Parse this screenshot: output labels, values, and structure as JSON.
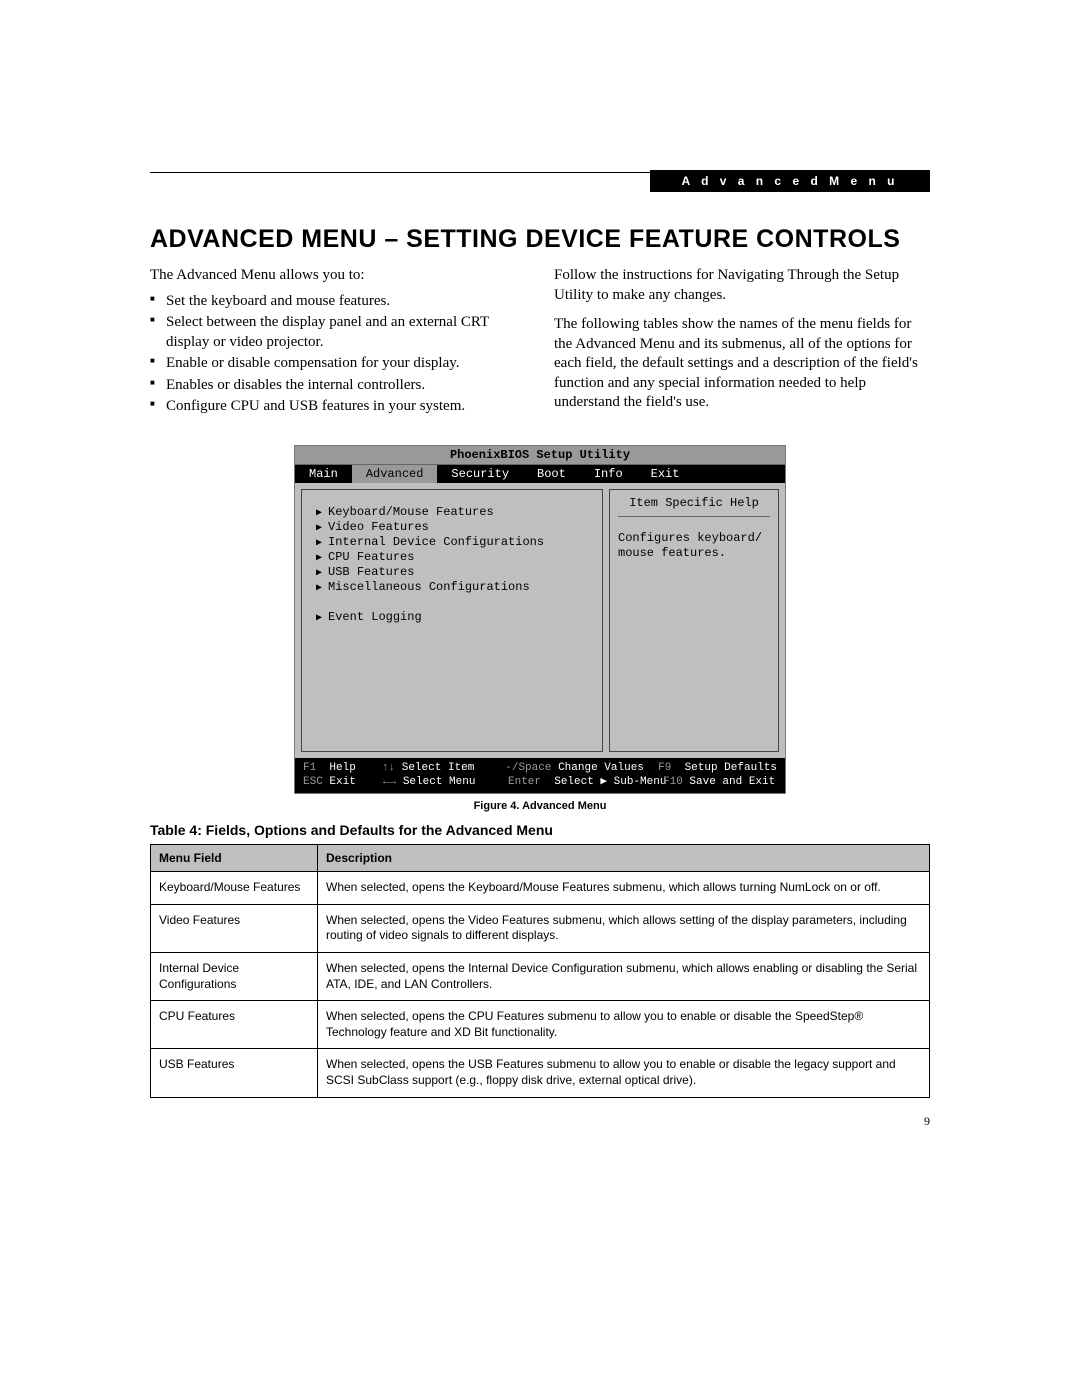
{
  "header": {
    "tag": "A d v a n c e d   M e n u",
    "title": "ADVANCED MENU – SETTING DEVICE FEATURE CONTROLS"
  },
  "intro": "The Advanced Menu allows you to:",
  "bullets": [
    "Set the keyboard and mouse features.",
    "Select between the display panel and an external CRT display or video projector.",
    "Enable or disable compensation for your display.",
    "Enables or disables the internal controllers.",
    "Configure CPU and USB features in your system."
  ],
  "right_paras": [
    "Follow the instructions for Navigating Through the Setup Utility to make any changes.",
    "The following tables show the names of the menu fields for the Advanced Menu and its submenus, all of the options for each field, the default settings and a description of the field's function and any special information needed to help understand the field's use."
  ],
  "bios": {
    "title": "PhoenixBIOS Setup Utility",
    "tabs": [
      "Main",
      "Advanced",
      "Security",
      "Boot",
      "Info",
      "Exit"
    ],
    "active_tab": "Advanced",
    "menu_items": [
      "Keyboard/Mouse Features",
      "Video Features",
      "Internal Device Configurations",
      "CPU Features",
      "USB Features",
      "Miscellaneous Configurations"
    ],
    "menu_items2": [
      "Event Logging"
    ],
    "help_title": "Item Specific Help",
    "help_text": "Configures keyboard/ mouse features.",
    "footer": {
      "r1c1a": "F1",
      "r1c1b": "Help",
      "r1c2a": "↑↓",
      "r1c2b": "Select Item",
      "r1c3a": "-/Space",
      "r1c3b": "Change Values",
      "r1c4a": "F9",
      "r1c4b": "Setup Defaults",
      "r2c1a": "ESC",
      "r2c1b": "Exit",
      "r2c2a": "←→",
      "r2c2b": "Select Menu",
      "r2c3a": "Enter",
      "r2c3b": "Select ▶ Sub-Menu",
      "r2c4a": "F10",
      "r2c4b": "Save and Exit"
    }
  },
  "figure_caption": "Figure 4.  Advanced Menu",
  "table_title": "Table 4: Fields, Options and Defaults for the Advanced Menu",
  "table": {
    "headers": [
      "Menu Field",
      "Description"
    ],
    "rows": [
      {
        "field": "Keyboard/Mouse Features",
        "desc": "When selected, opens the Keyboard/Mouse Features submenu, which allows turning NumLock on or off."
      },
      {
        "field": "Video Features",
        "desc": "When selected, opens the Video Features submenu, which allows setting of the display parameters, including routing of video signals to different displays."
      },
      {
        "field": "Internal Device Configurations",
        "desc": "When selected, opens the Internal Device Configuration submenu, which allows enabling or disabling the Serial ATA, IDE, and LAN Controllers."
      },
      {
        "field": "CPU Features",
        "desc": "When selected, opens the CPU Features submenu to allow you to enable or disable the SpeedStep® Technology feature and XD Bit functionality."
      },
      {
        "field": "USB Features",
        "desc": "When selected, opens the USB Features submenu to allow you to enable or disable the legacy support and SCSI SubClass support (e.g., floppy disk drive, external optical drive)."
      }
    ]
  },
  "page_number": "9"
}
